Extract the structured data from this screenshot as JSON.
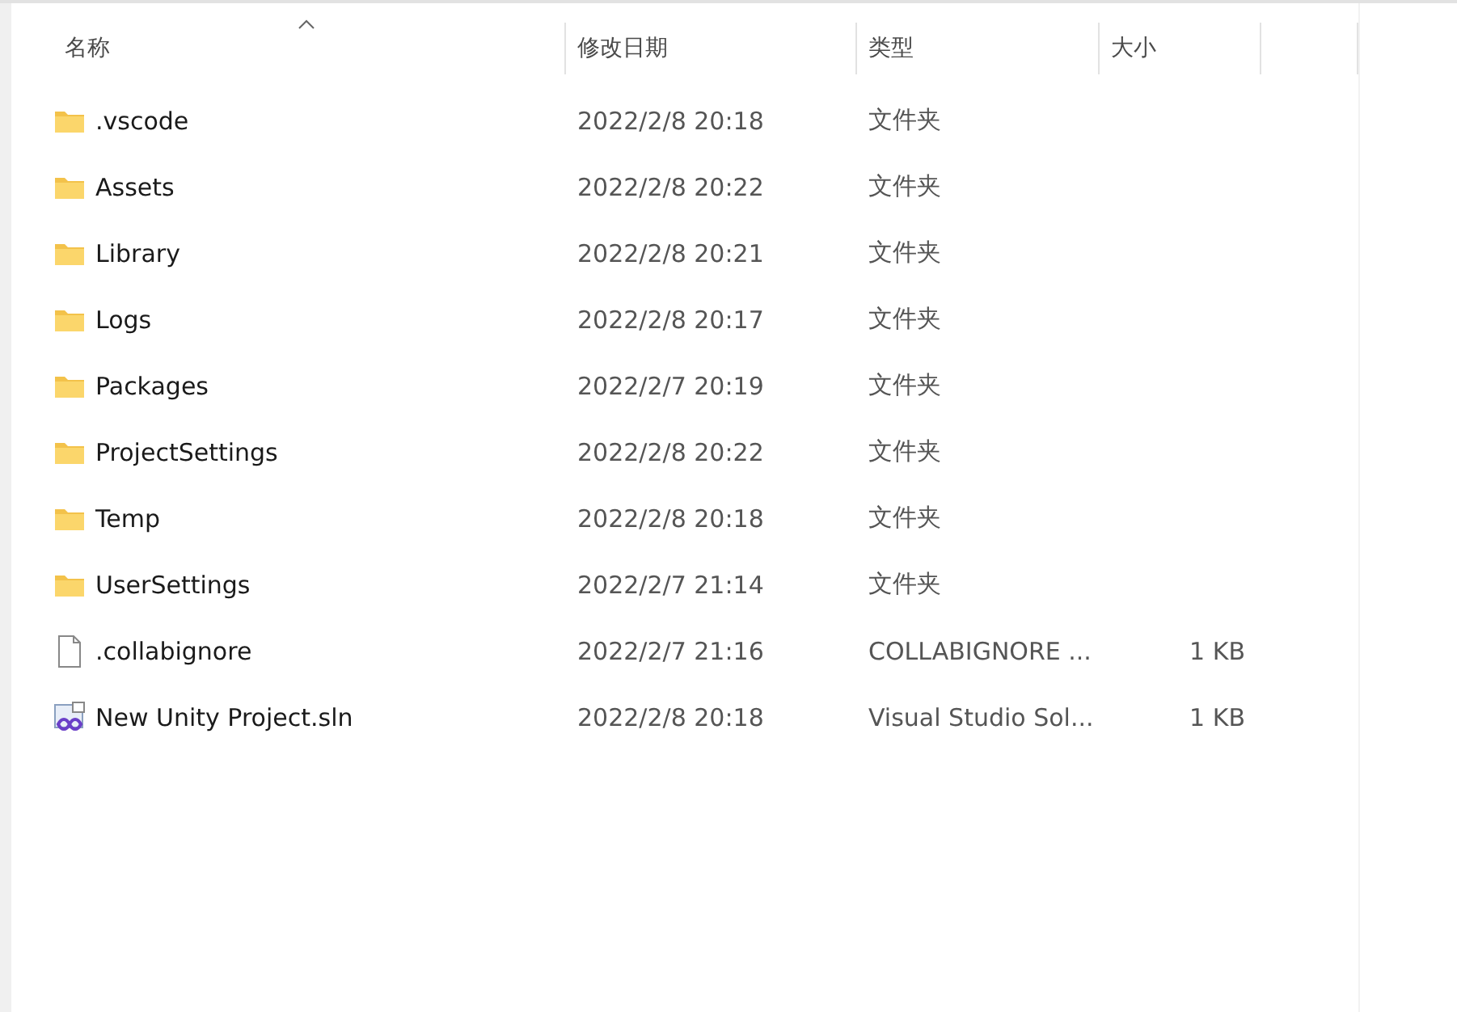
{
  "columns": [
    {
      "label": "名称",
      "sorted": true
    },
    {
      "label": "修改日期",
      "sorted": false
    },
    {
      "label": "类型",
      "sorted": false
    },
    {
      "label": "大小",
      "sorted": false
    }
  ],
  "rows": [
    {
      "kind": "folder",
      "name": ".vscode",
      "date": "2022/2/8 20:18",
      "type": "文件夹"
    },
    {
      "kind": "folder",
      "name": "Assets",
      "date": "2022/2/8 20:22",
      "type": "文件夹"
    },
    {
      "kind": "folder",
      "name": "Library",
      "date": "2022/2/8 20:21",
      "type": "文件夹"
    },
    {
      "kind": "folder",
      "name": "Logs",
      "date": "2022/2/8 20:17",
      "type": "文件夹"
    },
    {
      "kind": "folder",
      "name": "Packages",
      "date": "2022/2/7 20:19",
      "type": "文件夹"
    },
    {
      "kind": "folder",
      "name": "ProjectSettings",
      "date": "2022/2/8 20:22",
      "type": "文件夹"
    },
    {
      "kind": "folder",
      "name": "Temp",
      "date": "2022/2/8 20:18",
      "type": "文件夹"
    },
    {
      "kind": "folder",
      "name": "UserSettings",
      "date": "2022/2/7 21:14",
      "type": "文件夹"
    },
    {
      "kind": "file",
      "name": ".collabignore",
      "date": "2022/2/7 21:16",
      "type": "COLLABIGNORE ...",
      "size": "1 KB"
    },
    {
      "kind": "solution",
      "name": "New Unity Project.sln",
      "date": "2022/2/8 20:18",
      "type": "Visual Studio Sol...",
      "size": "1 KB"
    }
  ]
}
